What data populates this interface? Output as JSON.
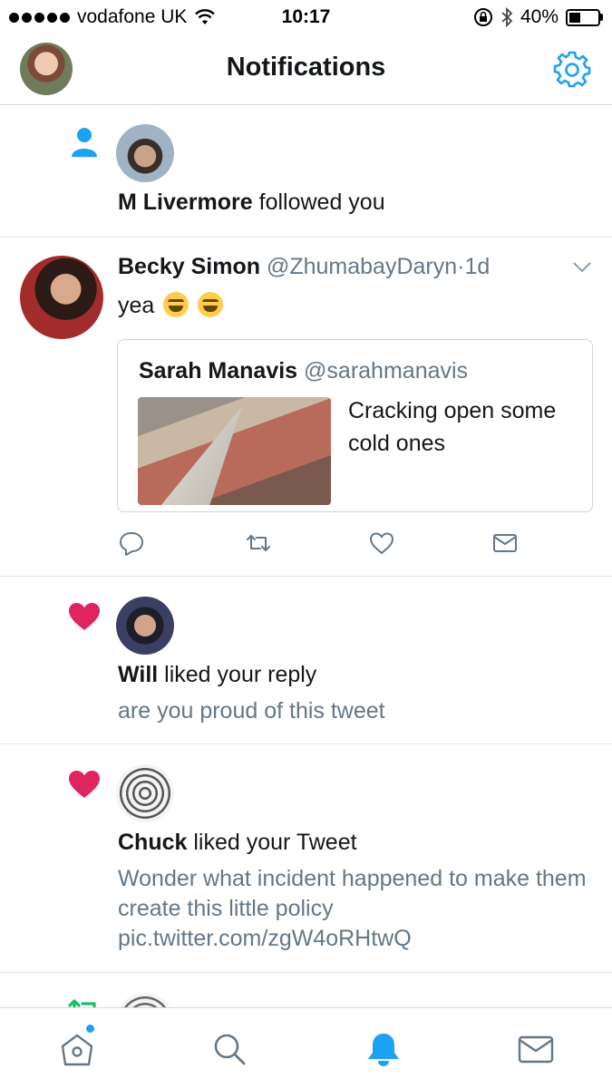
{
  "status_bar": {
    "carrier": "vodafone UK",
    "time": "10:17",
    "battery": "40%",
    "battery_level": 0.4
  },
  "header": {
    "title": "Notifications"
  },
  "notifications": [
    {
      "type": "follow",
      "icon": "person-icon",
      "user": "M Livermore",
      "action": "followed you"
    },
    {
      "type": "tweet",
      "name": "Becky Simon",
      "handle": "@ZhumabayDaryn",
      "separator": "·",
      "time": "1d",
      "text": "yea",
      "emoji": [
        "rolling-on-floor-laughing",
        "rolling-on-floor-laughing"
      ],
      "quote": {
        "name": "Sarah Manavis",
        "handle": "@sarahmanavis",
        "text": "Cracking open some cold ones"
      },
      "actions": [
        "reply-icon",
        "retweet-icon",
        "like-icon",
        "message-icon"
      ]
    },
    {
      "type": "like",
      "icon": "heart-icon",
      "user": "Will",
      "action": "liked your reply",
      "snippet": "are you proud of this tweet"
    },
    {
      "type": "like",
      "icon": "heart-icon",
      "user": "Chuck",
      "action": "liked your Tweet",
      "snippet": "Wonder what incident happened to make them create this little policy pic.twitter.com/zgW4oRHtwQ"
    },
    {
      "type": "retweet",
      "icon": "retweet-icon"
    }
  ],
  "tabbar": {
    "tabs": [
      "home-icon",
      "search-icon",
      "notifications-icon",
      "messages-icon"
    ],
    "active": "notifications-icon"
  },
  "colors": {
    "accent": "#1da1f2",
    "like": "#e0245e",
    "retweet": "#17bf63",
    "secondary_text": "#657786",
    "divider": "#e1e8ed"
  }
}
